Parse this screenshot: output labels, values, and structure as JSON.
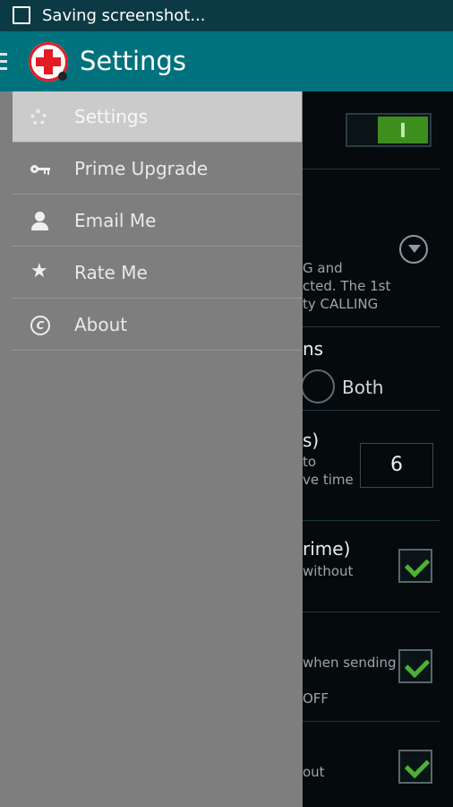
{
  "status_bar": {
    "text": "Saving screenshot..."
  },
  "action_bar": {
    "title": "Settings"
  },
  "drawer": {
    "items": [
      {
        "label": "Settings",
        "icon": "gear-icon",
        "active": true
      },
      {
        "label": "Prime Upgrade",
        "icon": "key-icon"
      },
      {
        "label": "Email Me",
        "icon": "person-icon"
      },
      {
        "label": "Rate Me",
        "icon": "star-icon"
      },
      {
        "label": "About",
        "icon": "copyright-icon",
        "glyph": "C"
      }
    ]
  },
  "background": {
    "text_lines": [
      "G and",
      "cted. The 1st",
      "ty CALLING",
      "to",
      "ve time",
      "without",
      "when sending",
      "OFF",
      "out"
    ],
    "headings": [
      "ns",
      "s)",
      "rime)"
    ],
    "radio_label": "Both",
    "number_value": "6",
    "toggle_on": true,
    "checkboxes_checked": [
      true,
      true,
      true
    ]
  },
  "colors": {
    "action_bar": "#00727d",
    "status_bar": "#0b3a44",
    "drawer": "#7e7e7e",
    "active_item": "#cbcbcb",
    "accent_green": "#4cb233"
  }
}
